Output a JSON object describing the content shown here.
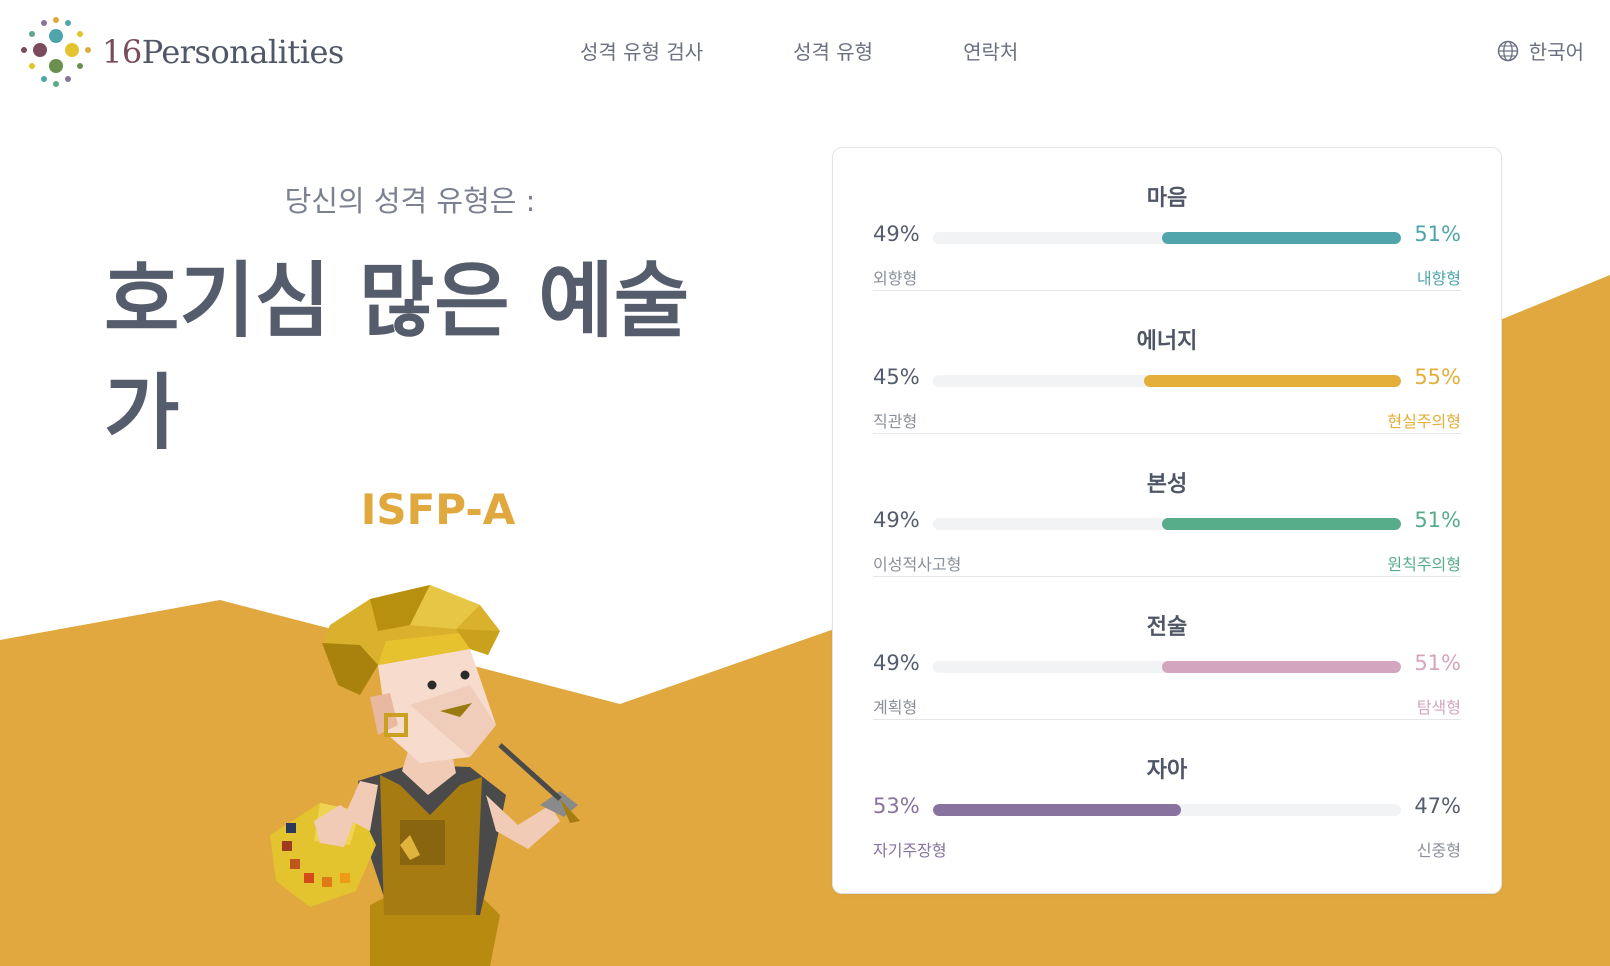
{
  "brand": {
    "logo_num": "16",
    "logo_word": "Personalities"
  },
  "nav": {
    "items": [
      {
        "label": "성격 유형 검사"
      },
      {
        "label": "성격 유형"
      },
      {
        "label": "연락처"
      }
    ],
    "language": "한국어",
    "language_icon": "globe-icon"
  },
  "hero": {
    "subtitle": "당신의 성격 유형은 :",
    "title": "호기심 많은 예술가",
    "code": "ISFP-A"
  },
  "traits": [
    {
      "name": "마음",
      "left_pct": "49%",
      "right_pct": "51%",
      "left_label": "외향형",
      "right_label": "내향형",
      "dominant": "right",
      "right_share": 0.51,
      "color": "#4fa5ab"
    },
    {
      "name": "에너지",
      "left_pct": "45%",
      "right_pct": "55%",
      "left_label": "직관형",
      "right_label": "현실주의형",
      "dominant": "right",
      "right_share": 0.55,
      "color": "#e4ae3a"
    },
    {
      "name": "본성",
      "left_pct": "49%",
      "right_pct": "51%",
      "left_label": "이성적사고형",
      "right_label": "원칙주의형",
      "dominant": "right",
      "right_share": 0.51,
      "color": "#57ac8a"
    },
    {
      "name": "전술",
      "left_pct": "49%",
      "right_pct": "51%",
      "left_label": "계획형",
      "right_label": "탐색형",
      "dominant": "right",
      "right_share": 0.51,
      "color": "#d3a6be"
    },
    {
      "name": "자아",
      "left_pct": "53%",
      "right_pct": "47%",
      "left_label": "자기주장형",
      "right_label": "신중형",
      "dominant": "left",
      "left_share": 0.53,
      "color": "#88739e"
    }
  ],
  "colors": {
    "background_gold": "#e0a83f",
    "heading": "#555c6b",
    "accent": "#e0a83d"
  }
}
